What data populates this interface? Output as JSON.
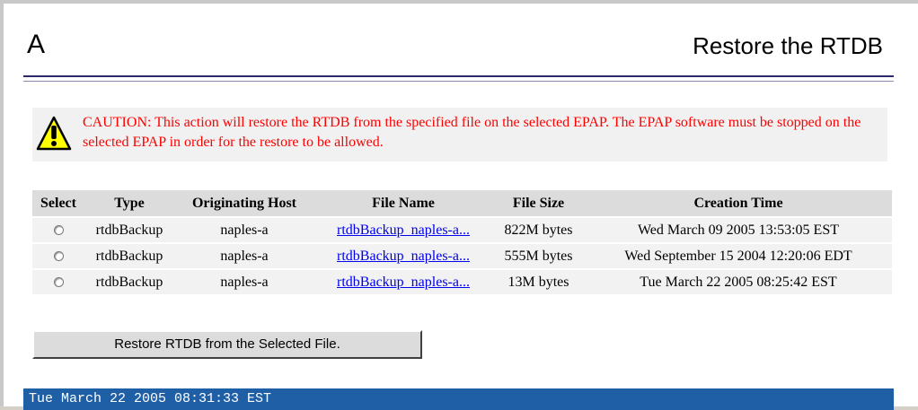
{
  "header": {
    "letter": "A",
    "title": "Restore the RTDB"
  },
  "caution": {
    "icon": "warning-icon",
    "text": "CAUTION: This action will restore the RTDB from the specified file on the selected EPAP. The EPAP software must be stopped on the selected EPAP in order for the restore to be allowed."
  },
  "table": {
    "headers": [
      "Select",
      "Type",
      "Originating Host",
      "File Name",
      "File Size",
      "Creation Time"
    ],
    "rows": [
      {
        "type": "rtdbBackup",
        "host": "naples-a",
        "file_name": "rtdbBackup_naples-a...",
        "file_size": "822M bytes",
        "created": "Wed March 09 2005 13:53:05 EST"
      },
      {
        "type": "rtdbBackup",
        "host": "naples-a",
        "file_name": "rtdbBackup_naples-a...",
        "file_size": "555M bytes",
        "created": "Wed September 15 2004 12:20:06 EDT"
      },
      {
        "type": "rtdbBackup",
        "host": "naples-a",
        "file_name": "rtdbBackup_naples-a...",
        "file_size": "13M bytes",
        "created": "Tue March 22 2005 08:25:42 EST"
      }
    ]
  },
  "restore_button_label": "Restore RTDB from the Selected File.",
  "status_bar": {
    "timestamp": "Tue March 22 2005 08:31:33 EST"
  },
  "colors": {
    "caution_text": "#ff0000",
    "status_bar_bg": "#1f5fa6",
    "header_rule": "#2a2a6a"
  }
}
